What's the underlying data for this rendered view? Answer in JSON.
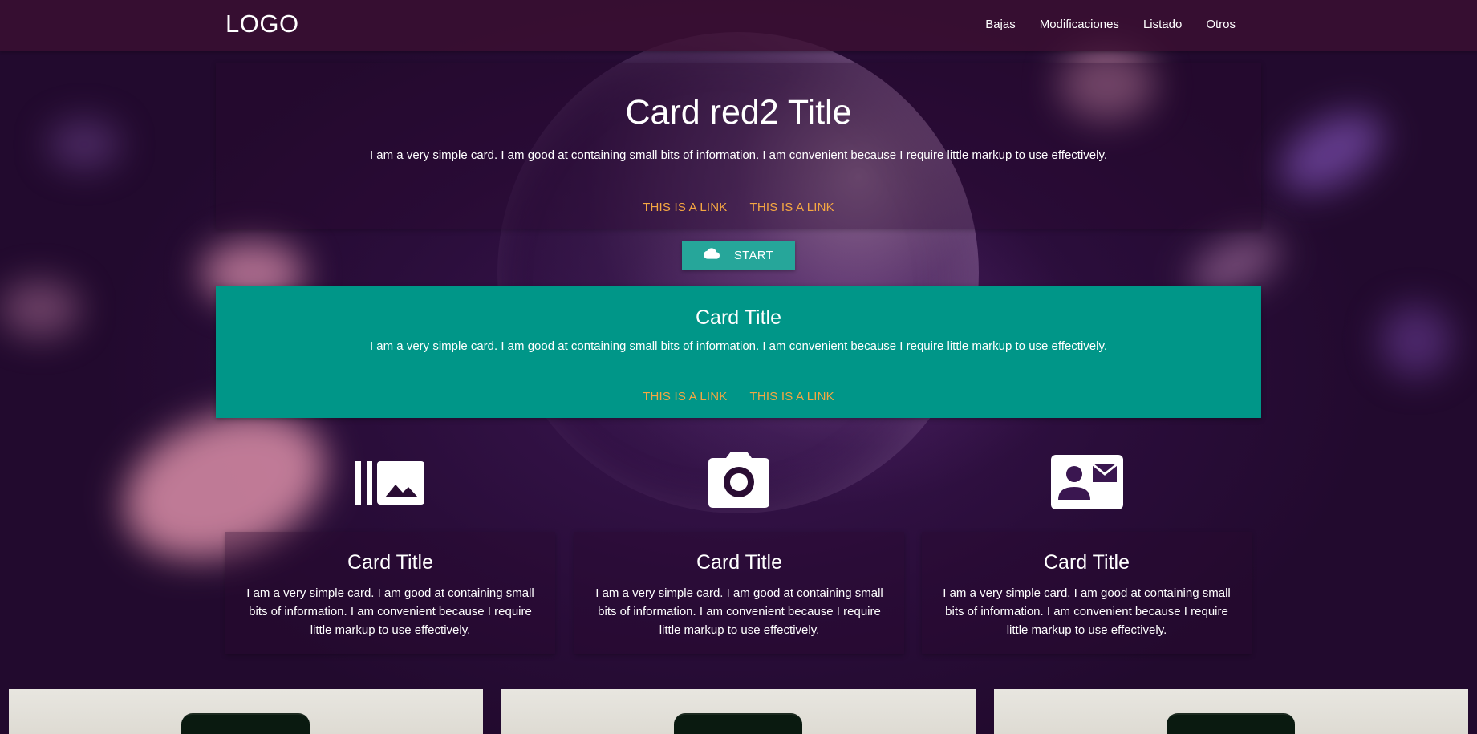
{
  "navbar": {
    "logo": "LOGO",
    "links": [
      "Bajas",
      "Modificaciones",
      "Listado",
      "Otros"
    ]
  },
  "top_card": {
    "title": "Card red2 Title",
    "text": "I am a very simple card. I am good at containing small bits of information. I am convenient because I require little markup to use effectively.",
    "links": [
      "THIS IS A LINK",
      "THIS IS A LINK"
    ]
  },
  "start_button": {
    "icon": "cloud-icon",
    "label": "START"
  },
  "teal_card": {
    "title": "Card Title",
    "text": "I am a very simple card. I am good at containing small bits of information. I am convenient because I require little markup to use effectively.",
    "links": [
      "THIS IS A LINK",
      "THIS IS A LINK"
    ]
  },
  "features": [
    {
      "icon": "photo-library-icon",
      "title": "Card Title",
      "text": "I am a very simple card. I am good at containing small bits of information. I am convenient because I require little markup to use effectively."
    },
    {
      "icon": "camera-icon",
      "title": "Card Title",
      "text": "I am a very simple card. I am good at containing small bits of information. I am convenient because I require little markup to use effectively."
    },
    {
      "icon": "contact-mail-icon",
      "title": "Card Title",
      "text": "I am a very simple card. I am good at containing small bits of information. I am convenient because I require little markup to use effectively."
    }
  ],
  "colors": {
    "navbar": "#3c0f32",
    "accent_teal": "#009688",
    "button_teal": "#26a69a",
    "link_orange": "#f5a742"
  }
}
